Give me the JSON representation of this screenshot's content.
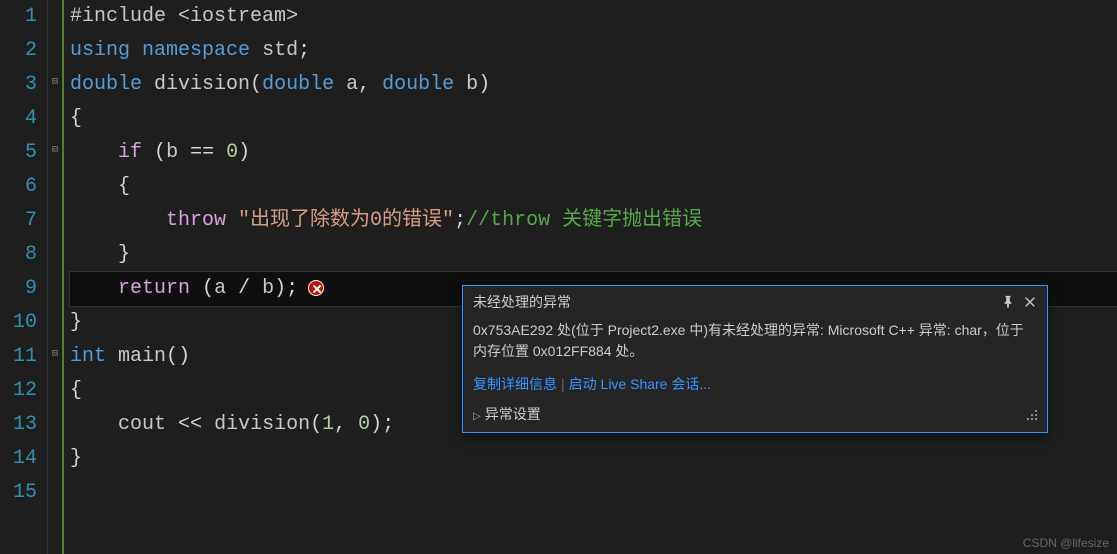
{
  "gutter": [
    "1",
    "2",
    "3",
    "4",
    "5",
    "6",
    "7",
    "8",
    "9",
    "10",
    "11",
    "12",
    "13",
    "14",
    "15"
  ],
  "fold": {
    "l3": "⊟",
    "l5": "⊟",
    "l11": "⊟"
  },
  "code": {
    "l1": {
      "directive": "#include",
      "lt": "<",
      "header": "iostream",
      "gt": ">"
    },
    "l2": {
      "using": "using",
      "namespace": "namespace",
      "std": "std",
      "semi": ";"
    },
    "l3": {
      "type": "double",
      "fn": "division",
      "lp": "(",
      "t1": "double",
      "p1": "a",
      "comma": ",",
      "t2": "double",
      "p2": "b",
      "rp": ")"
    },
    "l4": {
      "brace": "{"
    },
    "l5": {
      "if": "if",
      "lp": "(",
      "var": "b",
      "eq": "==",
      "zero": "0",
      "rp": ")"
    },
    "l6": {
      "brace": "{"
    },
    "l7": {
      "throw": "throw",
      "str": "\"出现了除数为0的错误\"",
      "semi": ";",
      "comment": "//throw 关键字抛出错误"
    },
    "l8": {
      "brace": "}"
    },
    "l9": {
      "return": "return",
      "lp": "(",
      "a": "a",
      "slash": "/",
      "b": "b",
      "rp": ")",
      "semi": ";"
    },
    "l10": {
      "brace": "}"
    },
    "l11": {
      "type": "int",
      "fn": "main",
      "lp": "(",
      "rp": ")"
    },
    "l12": {
      "brace": "{"
    },
    "l13": {
      "cout": "cout",
      "op": "<<",
      "fn": "division",
      "lp": "(",
      "a1": "1",
      "comma": ",",
      "a2": "0",
      "rp": ")",
      "semi": ";"
    },
    "l14": {
      "brace": "}"
    }
  },
  "popup": {
    "title": "未经处理的异常",
    "body": "0x753AE292 处(位于 Project2.exe 中)有未经处理的异常: Microsoft C++ 异常: char，位于内存位置 0x012FF884 处。",
    "link1": "复制详细信息",
    "link2": "启动 Live Share 会话...",
    "settings": "异常设置"
  },
  "watermark": "CSDN @lifesize"
}
